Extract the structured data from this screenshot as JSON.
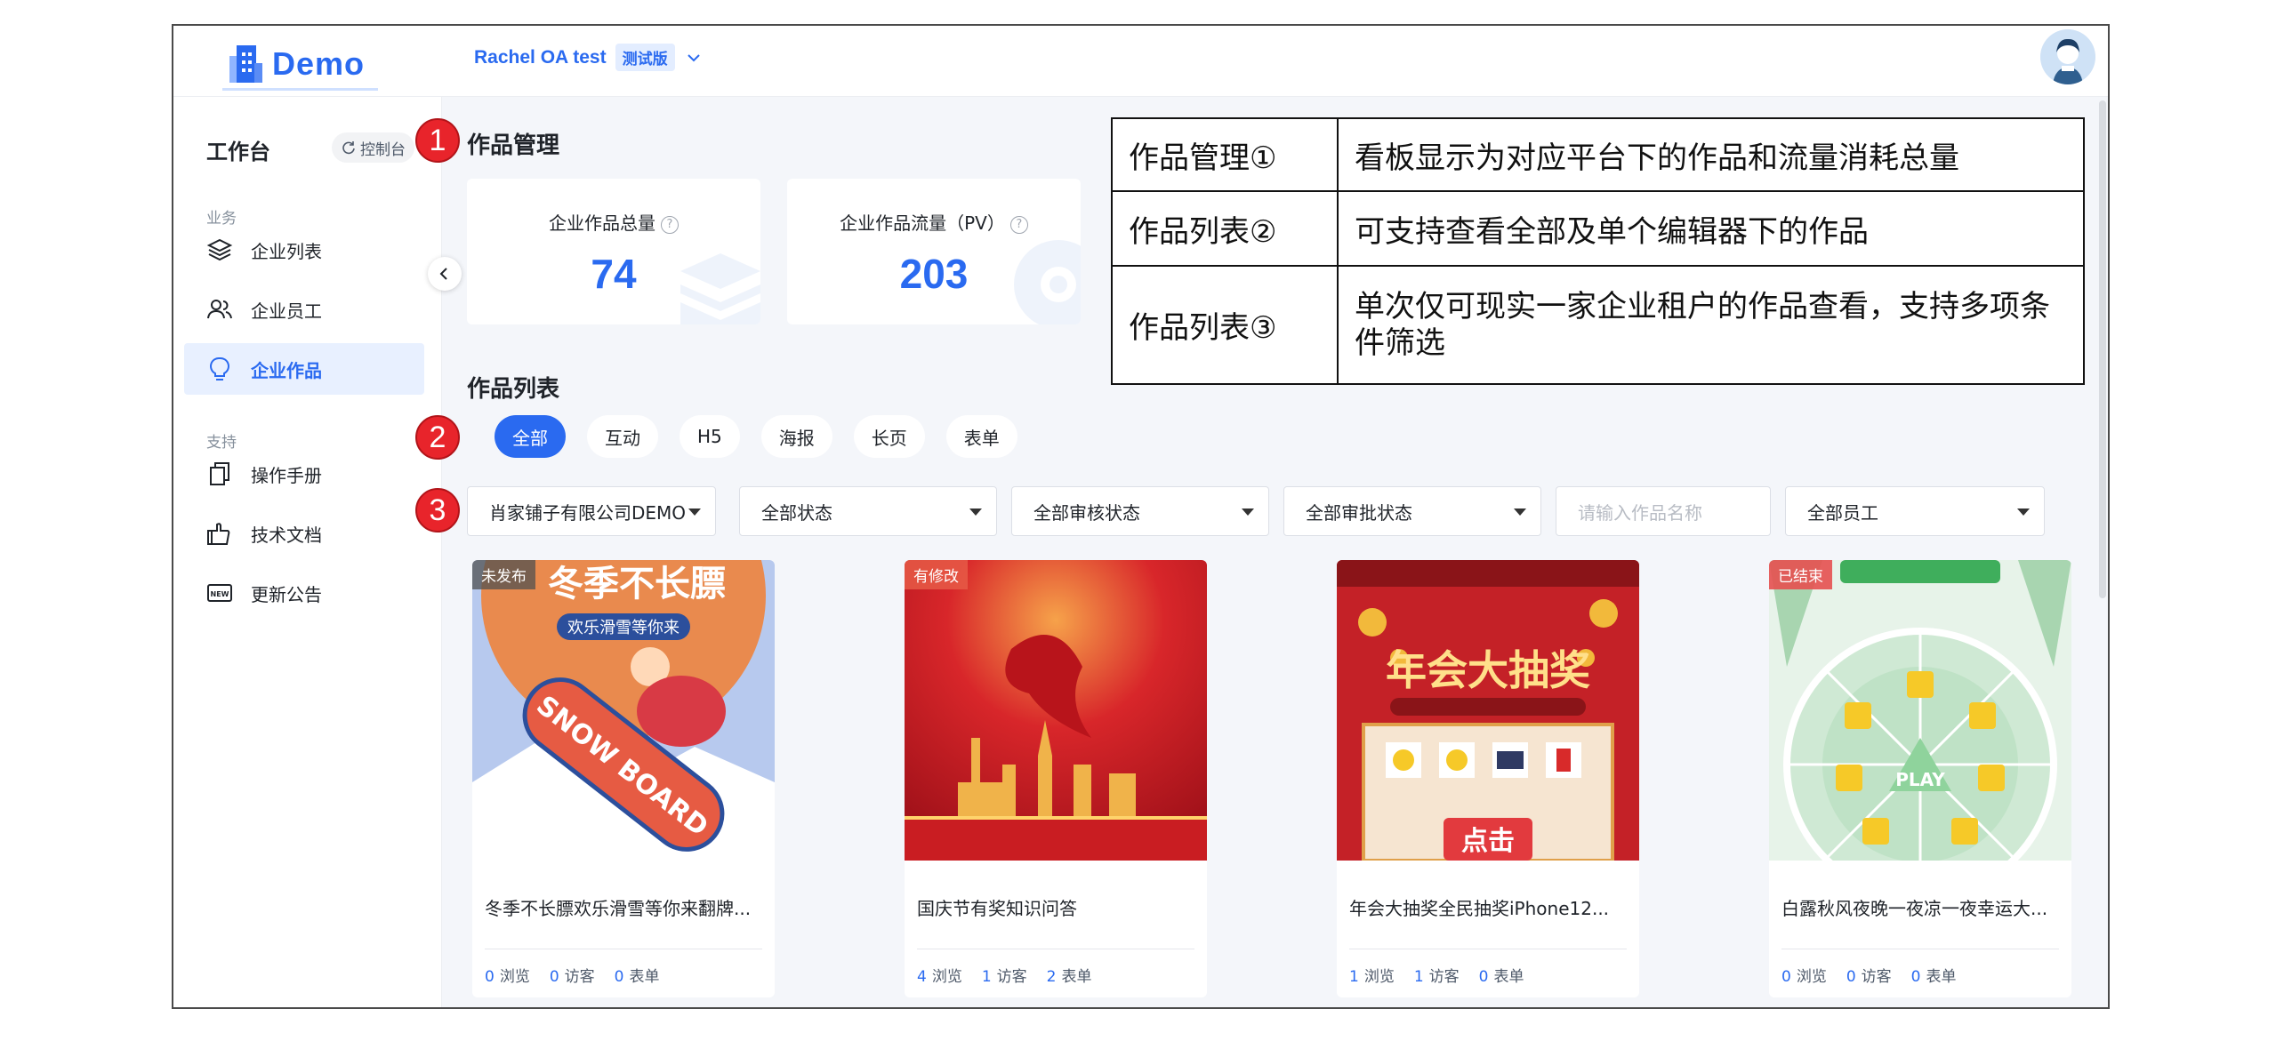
{
  "app": {
    "logo_text": "Demo",
    "tenant_name": "Rachel OA test",
    "tenant_badge": "测试版"
  },
  "sidebar": {
    "title": "工作台",
    "console_label": "控制台",
    "section_business": "业务",
    "section_support": "支持",
    "items": [
      {
        "label": "企业列表",
        "icon": "layers-icon"
      },
      {
        "label": "企业员工",
        "icon": "users-icon"
      },
      {
        "label": "企业作品",
        "icon": "lightbulb-icon",
        "active": true
      },
      {
        "label": "操作手册",
        "icon": "copy-icon"
      },
      {
        "label": "技术文档",
        "icon": "document-hand-icon"
      },
      {
        "label": "更新公告",
        "icon": "new-badge-icon"
      }
    ]
  },
  "markers": [
    "1",
    "2",
    "3"
  ],
  "main": {
    "management_title": "作品管理",
    "stats": [
      {
        "label": "企业作品总量",
        "value": "74"
      },
      {
        "label": "企业作品流量（PV）",
        "value": "203"
      }
    ],
    "list_title": "作品列表",
    "filters": [
      "全部",
      "互动",
      "H5",
      "海报",
      "长页",
      "表单"
    ],
    "selects": {
      "company": "肖家铺子有限公司DEMO",
      "status": "全部状态",
      "review": "全部审核状态",
      "approval": "全部审批状态",
      "name_placeholder": "请输入作品名称",
      "staff": "全部员工"
    }
  },
  "annotation_table": [
    {
      "key": "作品管理①",
      "desc": "看板显示为对应平台下的作品和流量消耗总量"
    },
    {
      "key": "作品列表②",
      "desc": "可支持查看全部及单个编辑器下的作品"
    },
    {
      "key": "作品列表③",
      "desc": "单次仅可现实一家企业租户的作品查看，支持多项条件筛选"
    }
  ],
  "works": [
    {
      "badge": "未发布",
      "thumb_text": "冬季不长膘",
      "thumb_sub": "欢乐滑雪等你来",
      "title": "冬季不长膘欢乐滑雪等你来翻牌...",
      "views": "0",
      "visitors": "0",
      "forms": "0"
    },
    {
      "badge": "有修改",
      "title": "国庆节有奖知识问答",
      "views": "4",
      "visitors": "1",
      "forms": "2"
    },
    {
      "badge": "",
      "thumb_text": "年会大抽奖",
      "title": "年会大抽奖全民抽奖iPhone12...",
      "views": "1",
      "visitors": "1",
      "forms": "0"
    },
    {
      "badge": "已结束",
      "thumb_text": "PLAY",
      "title": "白露秋风夜晚一夜凉一夜幸运大...",
      "views": "0",
      "visitors": "0",
      "forms": "0"
    }
  ],
  "stat_labels": {
    "views": "浏览",
    "visitors": "访客",
    "forms": "表单"
  },
  "colors": {
    "accent": "#2a6af0",
    "marker": "#e8242b",
    "active_nav_bg": "#e8f0ff"
  }
}
